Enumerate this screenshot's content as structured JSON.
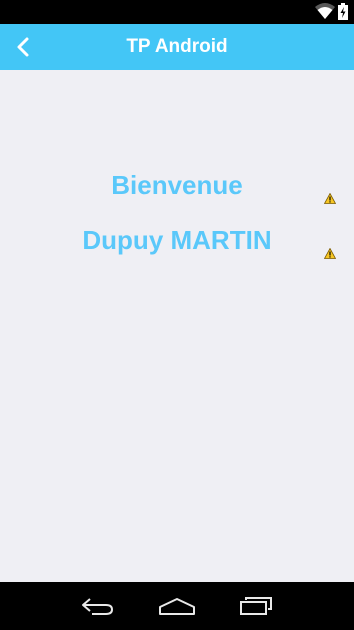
{
  "app_bar": {
    "title": "TP Android",
    "background_color": "#43c6f6",
    "back_icon": "chevron-left-icon"
  },
  "content": {
    "welcome": "Bienvenue",
    "user_name": "Dupuy MARTIN",
    "text_color": "#5ac8fa",
    "warning_icon": "warning-icon"
  },
  "status_bar": {
    "icons": [
      "wifi-icon",
      "battery-charging-icon"
    ]
  },
  "nav_bar": {
    "buttons": [
      "back-nav-icon",
      "home-nav-icon",
      "recents-nav-icon"
    ]
  }
}
